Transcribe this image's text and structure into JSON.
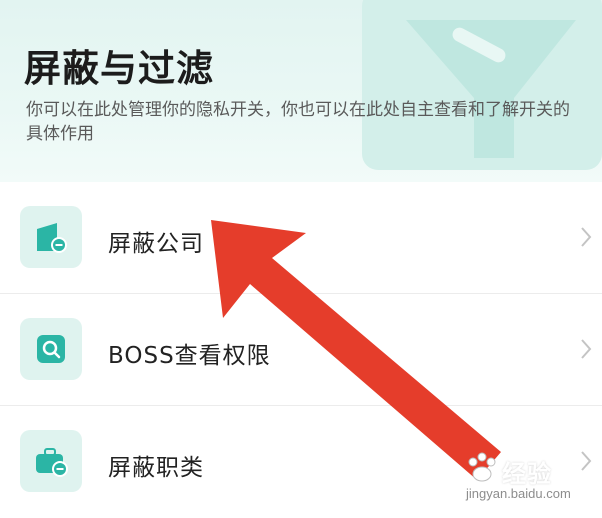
{
  "header": {
    "title": "屏蔽与过滤",
    "description": "你可以在此处管理你的隐私开关，你也可以在此处自主查看和了解开关的具体作用"
  },
  "items": [
    {
      "label": "屏蔽公司",
      "icon": "company-block-icon"
    },
    {
      "label": "BOSS查看权限",
      "icon": "search-icon"
    },
    {
      "label": "屏蔽职类",
      "icon": "briefcase-block-icon"
    }
  ],
  "watermark": {
    "text": "经验",
    "url": "jingyan.baidu.com"
  },
  "colors": {
    "accent": "#2bb5a5",
    "tile_bg": "#dff3ef",
    "header_bg": "#e6f6f3",
    "arrow": "#e53d2b"
  }
}
